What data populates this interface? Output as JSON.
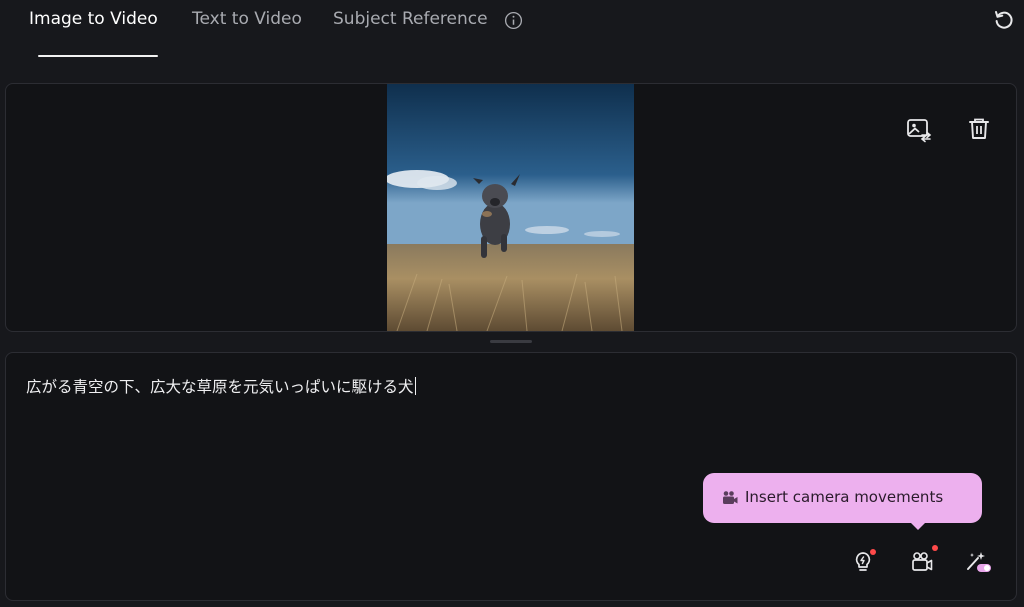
{
  "tabs": [
    {
      "label": "Image to Video",
      "active": true
    },
    {
      "label": "Text to Video",
      "active": false
    },
    {
      "label": "Subject Reference",
      "active": false
    }
  ],
  "icons": {
    "info": "info-icon",
    "refresh": "refresh-icon",
    "replace_image": "image-replace-icon",
    "delete": "trash-icon",
    "inspiration": "lightbulb-icon",
    "camera": "video-camera-icon",
    "enhance": "magic-wand-icon"
  },
  "prompt": {
    "text": "広がる青空の下、広大な草原を元気いっぱいに駆ける犬"
  },
  "tooltip": {
    "label": "Insert camera movements"
  },
  "colors": {
    "background": "#17181c",
    "panel": "#121316",
    "tooltip": "#edb0ee",
    "notification_dot": "#ff4a4a"
  }
}
